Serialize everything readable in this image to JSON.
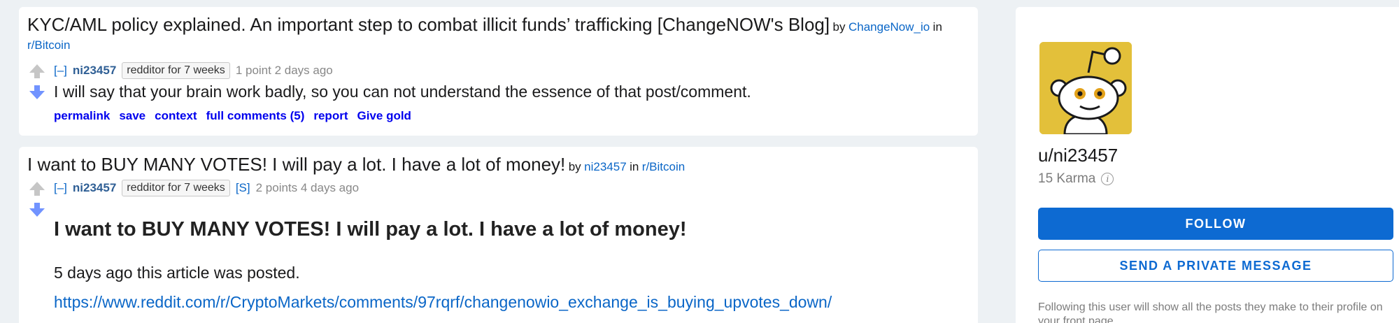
{
  "posts": [
    {
      "title": "KYC/AML policy explained. An important step to combat illicit funds’ trafficking [ChangeNOW's Blog]",
      "by_label": "by",
      "poster": "ChangeNow_io",
      "in_label": "in",
      "subreddit": "r/Bitcoin",
      "comment": {
        "collapse": "[–]",
        "author": "ni23457",
        "flair": "redditor for 7 weeks",
        "score_time": "1 point 2 days ago",
        "body": "I will say that your brain work badly, so you can not understand the essence of that post/comment.",
        "actions": [
          "permalink",
          "save",
          "context",
          "full comments (5)",
          "report",
          "Give gold"
        ]
      }
    },
    {
      "title": "I want to BUY MANY VOTES! I will pay a lot. I have a lot of money!",
      "by_label": "by",
      "poster": "ni23457",
      "in_label": "in",
      "subreddit": "r/Bitcoin",
      "comment": {
        "collapse": "[–]",
        "author": "ni23457",
        "flair": "redditor for 7 weeks",
        "s_tag": "[S]",
        "score_time": "2 points 4 days ago",
        "heading": "I want to BUY MANY VOTES! I will pay a lot. I have a lot of money!",
        "paragraph": "5 days ago this article was posted.",
        "url": "https://www.reddit.com/r/CryptoMarkets/comments/97rqrf/changenowio_exchange_is_buying_upvotes_down/"
      }
    }
  ],
  "sidebar": {
    "avatar_icon": "snoo-avatar-icon",
    "username": "u/ni23457",
    "karma": "15 Karma",
    "follow_label": "FOLLOW",
    "message_label": "SEND A PRIVATE MESSAGE",
    "follow_note": "Following this user will show all the posts they make to their profile on your front page."
  },
  "colors": {
    "page_bg": "#edf1f4",
    "link": "#0a66c7",
    "button": "#0d6ad2",
    "upvote": "#c6c6c6",
    "downvote": "#7193ff",
    "avatar_bg": "#e3c03a"
  }
}
